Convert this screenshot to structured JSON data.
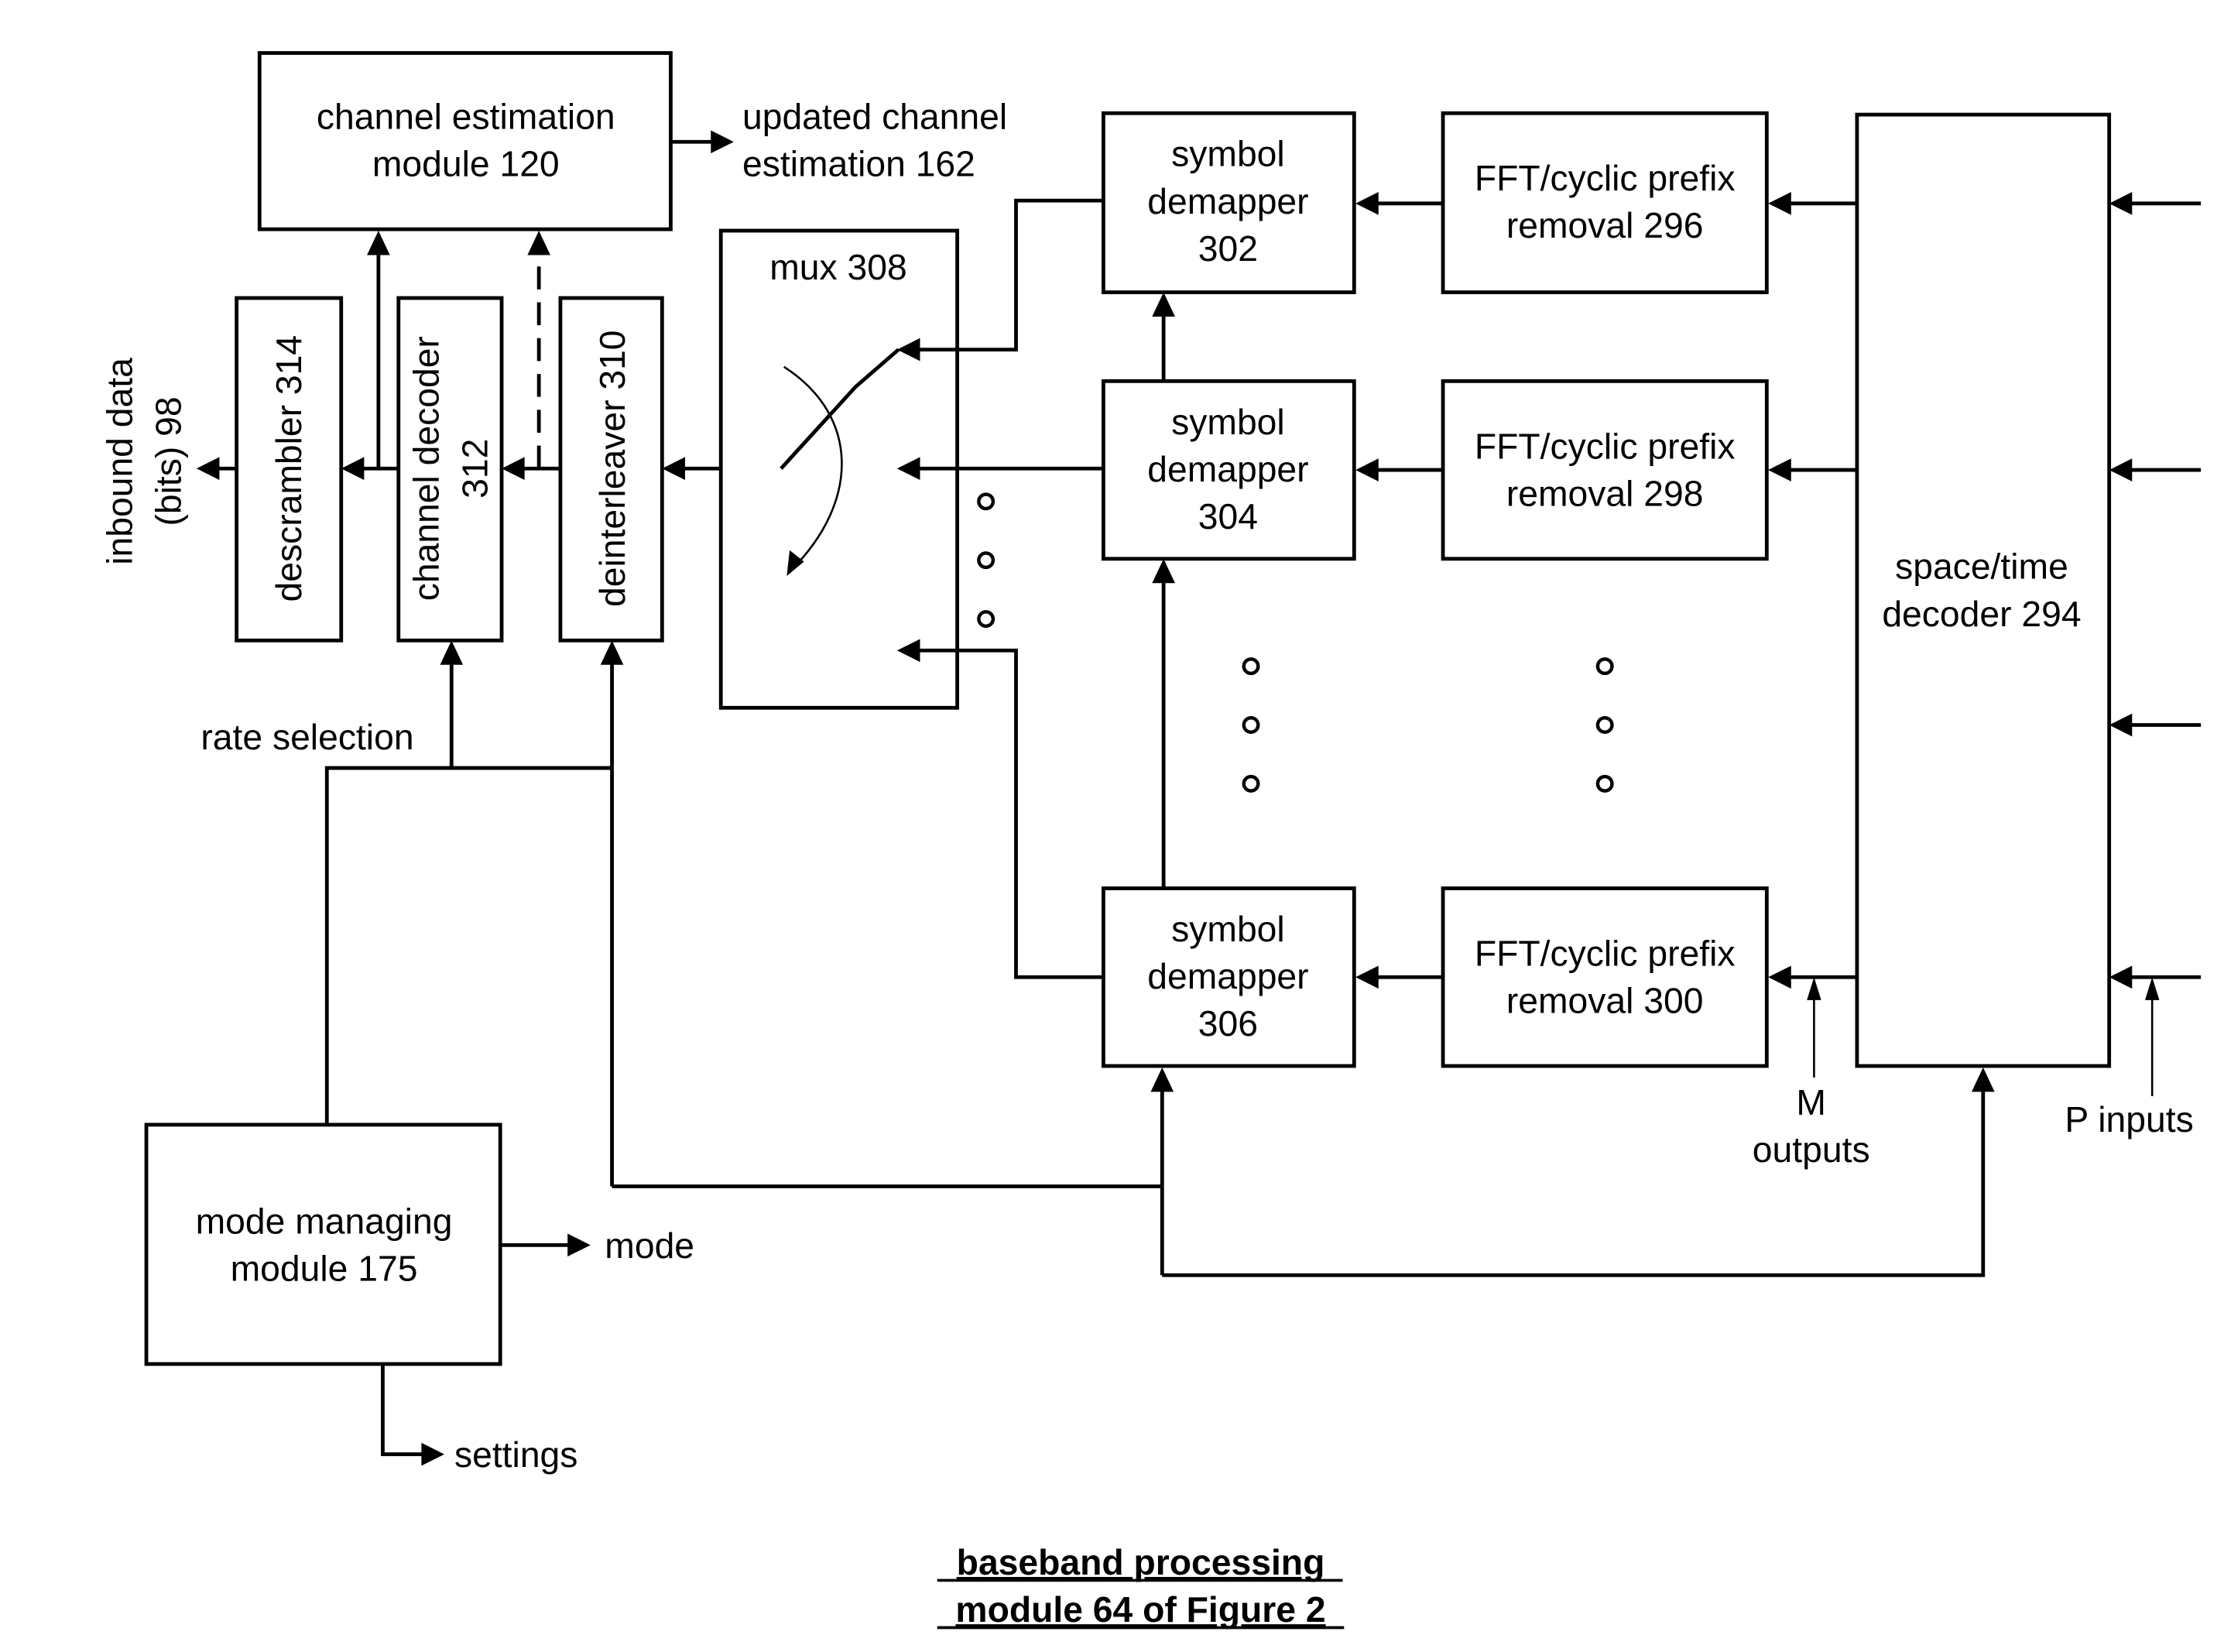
{
  "figure": {
    "caption_line1": "baseband processing",
    "caption_line2": "module 64 of Figure 2"
  },
  "blocks": {
    "channel_estimation": [
      "channel estimation",
      "module 120"
    ],
    "updated_estimation": [
      "updated channel",
      "estimation 162"
    ],
    "mux": "mux 308",
    "descrambler": "descrambler 314",
    "channel_decoder": [
      "channel decoder",
      "312"
    ],
    "deinterleaver": "deinterleaver 310",
    "inbound_data": [
      "inbound data",
      "(bits) 98"
    ],
    "symbol_demapper_302": [
      "symbol",
      "demapper",
      "302"
    ],
    "symbol_demapper_304": [
      "symbol",
      "demapper",
      "304"
    ],
    "symbol_demapper_306": [
      "symbol",
      "demapper",
      "306"
    ],
    "fft_296": [
      "FFT/cyclic prefix",
      "removal 296"
    ],
    "fft_298": [
      "FFT/cyclic prefix",
      "removal 298"
    ],
    "fft_300": [
      "FFT/cyclic prefix",
      "removal 300"
    ],
    "space_time_decoder": [
      "space/time",
      "decoder 294"
    ],
    "mode_managing": [
      "mode managing",
      "module 175"
    ]
  },
  "signals": {
    "rate_selection": "rate selection",
    "mode": "mode",
    "settings": "settings",
    "m_outputs": [
      "M",
      "outputs"
    ],
    "p_inputs": "P inputs"
  }
}
